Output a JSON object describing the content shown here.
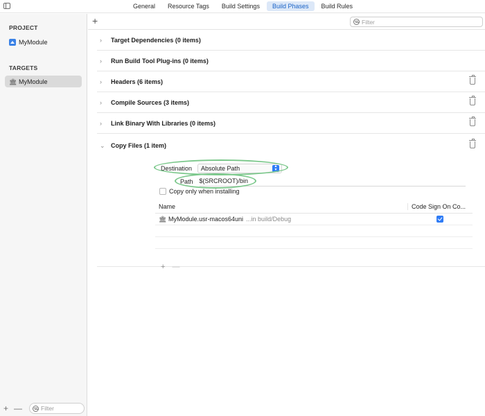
{
  "tabs": [
    {
      "label": "General",
      "active": false
    },
    {
      "label": "Resource Tags",
      "active": false
    },
    {
      "label": "Build Settings",
      "active": false
    },
    {
      "label": "Build Phases",
      "active": true
    },
    {
      "label": "Build Rules",
      "active": false
    }
  ],
  "sidebar": {
    "project_heading": "PROJECT",
    "project_item": "MyModule",
    "targets_heading": "TARGETS",
    "target_item": "MyModule",
    "filter_placeholder": "Filter",
    "add_glyph": "+",
    "remove_glyph": "—"
  },
  "main": {
    "add_glyph": "+",
    "filter_placeholder": "Filter",
    "phases": [
      {
        "title": "Target Dependencies (0 items)",
        "deletable": false
      },
      {
        "title": "Run Build Tool Plug-ins (0 items)",
        "deletable": false
      },
      {
        "title": "Headers (6 items)",
        "deletable": true
      },
      {
        "title": "Compile Sources (3 items)",
        "deletable": true
      },
      {
        "title": "Link Binary With Libraries (0 items)",
        "deletable": true
      }
    ],
    "copy_files": {
      "title": "Copy Files (1 item)",
      "destination_label": "Destination",
      "destination_value": "Absolute Path",
      "path_label": "Path",
      "path_value": "$(SRCROOT)/bin",
      "copy_only_label": "Copy only when installing",
      "copy_only_checked": false,
      "table": {
        "col_name": "Name",
        "col_sign": "Code Sign On Co...",
        "rows": [
          {
            "name": "MyModule.usr-macos64uni",
            "location": "...in build/Debug",
            "code_sign": true
          }
        ]
      },
      "footer_add": "+",
      "footer_remove": "—"
    }
  },
  "colors": {
    "accent": "#2f7cf6",
    "selected_tab_bg": "#dce8f8",
    "annotation_ring": "#7ac78a"
  }
}
